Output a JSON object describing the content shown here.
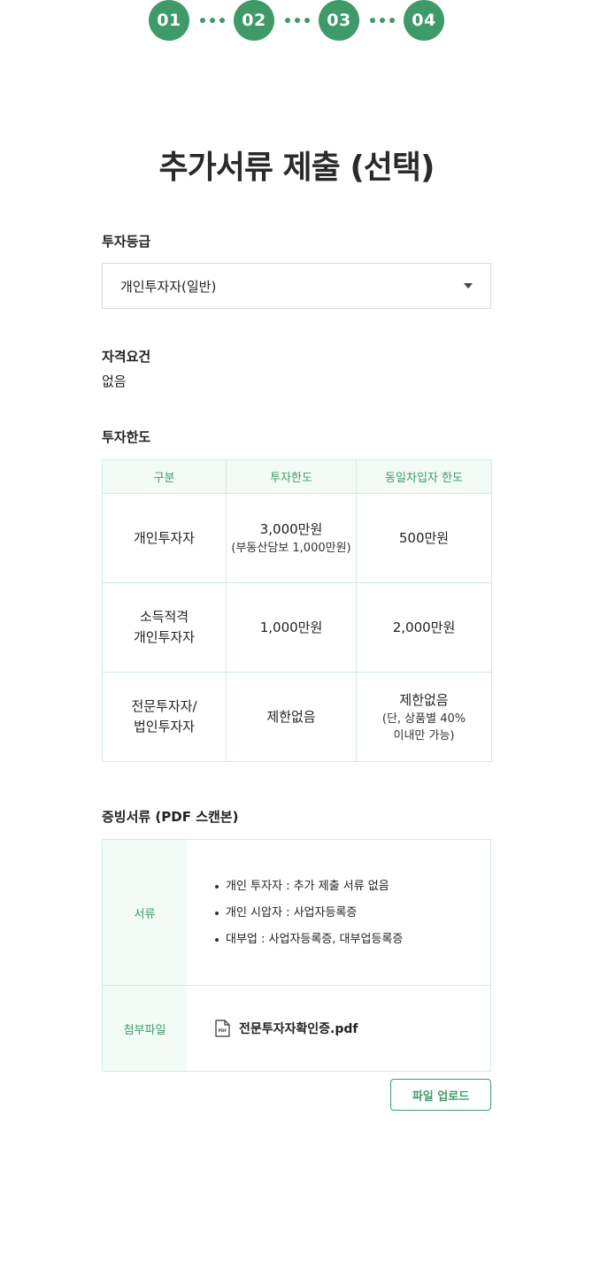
{
  "steps": [
    "01",
    "02",
    "03",
    "04"
  ],
  "title": "추가서류 제출 (선택)",
  "grade": {
    "label": "투자등급",
    "selected": "개인투자자(일반)"
  },
  "requirements": {
    "label": "자격요건",
    "value": "없음"
  },
  "limits": {
    "label": "투자한도",
    "headers": [
      "구분",
      "투자한도",
      "동일차입자 한도"
    ],
    "rows": [
      {
        "type": [
          "개인투자자"
        ],
        "limit": "3,000만원",
        "limit_note": "(부동산담보 1,000만원)",
        "borrower": "500만원",
        "borrower_note": []
      },
      {
        "type": [
          "소득적격",
          "개인투자자"
        ],
        "limit": "1,000만원",
        "limit_note": "",
        "borrower": "2,000만원",
        "borrower_note": []
      },
      {
        "type": [
          "전문투자자/",
          "법인투자자"
        ],
        "limit": "제한없음",
        "limit_note": "",
        "borrower": "제한없음",
        "borrower_note": [
          "(단, 상품별 40%",
          "이내만 가능)"
        ]
      }
    ]
  },
  "docs": {
    "label": "증빙서류 (PDF 스캔본)",
    "doc_head": "서류",
    "items": [
      "개인 투자자 : 추가 제출 서류 없음",
      "개인 시압자 : 사업자등록증",
      "대부업 : 사업자등록증, 대부업등록증"
    ],
    "attach_head": "첨부파일",
    "file_name": "전문투자자확인증.pdf",
    "file_icon_text": "PDF"
  },
  "upload_button": "파일 업로드",
  "colors": {
    "accent": "#3f9a6a",
    "header_bg": "#f3fbf6",
    "border": "#d3ebe0"
  }
}
